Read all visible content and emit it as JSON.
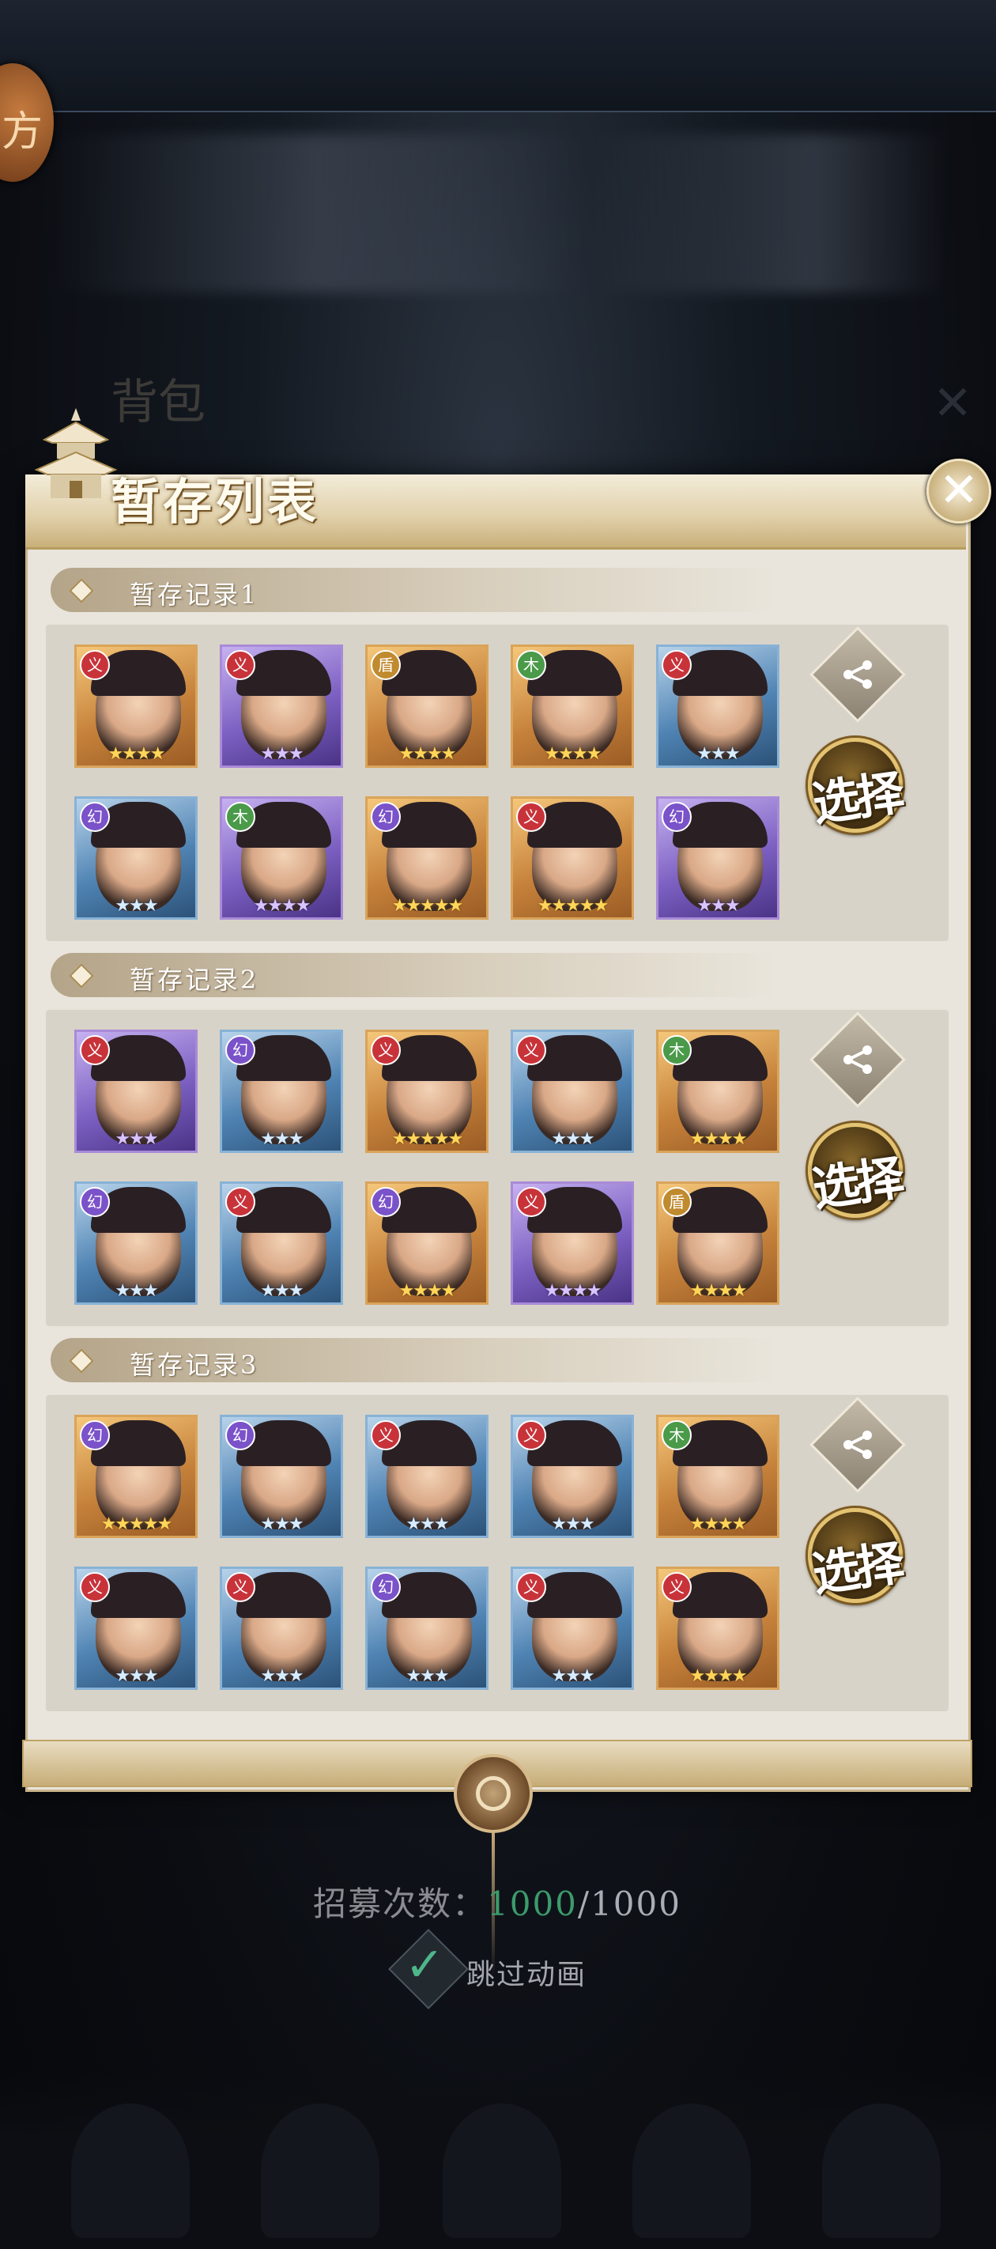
{
  "background": {
    "corner_badge_text": "方",
    "back_title": "背包"
  },
  "panel": {
    "title": "暂存列表"
  },
  "records": [
    {
      "label": "暂存记录1",
      "select_label": "选择",
      "heroes": [
        {
          "rarity": "gold",
          "faction": "red",
          "stars": 4
        },
        {
          "rarity": "purple",
          "faction": "red",
          "stars": 3
        },
        {
          "rarity": "gold",
          "faction": "gold",
          "stars": 4
        },
        {
          "rarity": "gold",
          "faction": "green",
          "stars": 4
        },
        {
          "rarity": "blue",
          "faction": "red",
          "stars": 3
        },
        {
          "rarity": "blue",
          "faction": "purple",
          "stars": 3
        },
        {
          "rarity": "purple",
          "faction": "green",
          "stars": 4
        },
        {
          "rarity": "gold",
          "faction": "purple",
          "stars": 5
        },
        {
          "rarity": "gold",
          "faction": "red",
          "stars": 5
        },
        {
          "rarity": "purple",
          "faction": "purple",
          "stars": 3
        }
      ]
    },
    {
      "label": "暂存记录2",
      "select_label": "选择",
      "heroes": [
        {
          "rarity": "purple",
          "faction": "red",
          "stars": 3
        },
        {
          "rarity": "blue",
          "faction": "purple",
          "stars": 3
        },
        {
          "rarity": "gold",
          "faction": "red",
          "stars": 5
        },
        {
          "rarity": "blue",
          "faction": "red",
          "stars": 3
        },
        {
          "rarity": "gold",
          "faction": "green",
          "stars": 4
        },
        {
          "rarity": "blue",
          "faction": "purple",
          "stars": 3
        },
        {
          "rarity": "blue",
          "faction": "red",
          "stars": 3
        },
        {
          "rarity": "gold",
          "faction": "purple",
          "stars": 4
        },
        {
          "rarity": "purple",
          "faction": "red",
          "stars": 4
        },
        {
          "rarity": "gold",
          "faction": "gold",
          "stars": 4
        }
      ]
    },
    {
      "label": "暂存记录3",
      "select_label": "选择",
      "heroes": [
        {
          "rarity": "gold",
          "faction": "purple",
          "stars": 5
        },
        {
          "rarity": "blue",
          "faction": "purple",
          "stars": 3
        },
        {
          "rarity": "blue",
          "faction": "red",
          "stars": 3
        },
        {
          "rarity": "blue",
          "faction": "red",
          "stars": 3
        },
        {
          "rarity": "gold",
          "faction": "green",
          "stars": 4
        },
        {
          "rarity": "blue",
          "faction": "red",
          "stars": 3
        },
        {
          "rarity": "blue",
          "faction": "red",
          "stars": 3
        },
        {
          "rarity": "blue",
          "faction": "purple",
          "stars": 3
        },
        {
          "rarity": "blue",
          "faction": "red",
          "stars": 3
        },
        {
          "rarity": "gold",
          "faction": "red",
          "stars": 4
        }
      ]
    }
  ],
  "recruit": {
    "label": "招募次数：",
    "current": "1000",
    "separator": "/",
    "max": "1000"
  },
  "skip_animation": {
    "label": "跳过动画",
    "checked": true
  },
  "colors": {
    "accent_gold": "#d9a45a",
    "count_green": "#3c9b6c"
  }
}
